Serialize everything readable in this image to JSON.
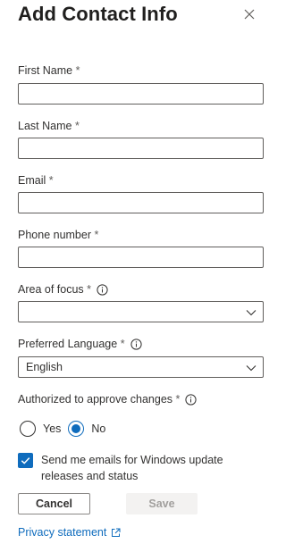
{
  "dialog": {
    "title": "Add Contact Info",
    "close_icon": "close-icon"
  },
  "fields": {
    "first_name": {
      "label": "First Name",
      "required_mark": "*",
      "value": ""
    },
    "last_name": {
      "label": "Last Name",
      "required_mark": "*",
      "value": ""
    },
    "email": {
      "label": "Email",
      "required_mark": "*",
      "value": ""
    },
    "phone": {
      "label": "Phone number",
      "required_mark": "*",
      "value": ""
    },
    "area_of_focus": {
      "label": "Area of focus",
      "required_mark": "*",
      "value": "",
      "info_icon": "info-icon",
      "dropdown_icon": "chevron-down-icon"
    },
    "preferred_language": {
      "label": "Preferred Language",
      "required_mark": "*",
      "value": "English",
      "info_icon": "info-icon",
      "dropdown_icon": "chevron-down-icon"
    }
  },
  "authorized": {
    "label": "Authorized to approve changes",
    "required_mark": "*",
    "info_icon": "info-icon",
    "options": [
      {
        "label": "Yes",
        "checked": false
      },
      {
        "label": "No",
        "checked": true
      }
    ]
  },
  "email_updates": {
    "checked": true,
    "label": "Send me emails for Windows update releases and status"
  },
  "buttons": {
    "cancel": "Cancel",
    "save": "Save",
    "save_enabled": false
  },
  "privacy": {
    "label": "Privacy statement",
    "icon": "external-link-icon"
  },
  "colors": {
    "accent": "#0f6cbd",
    "text": "#323130",
    "border": "#605e5c",
    "disabled_bg": "#f3f2f1",
    "disabled_text": "#a19f9d"
  }
}
